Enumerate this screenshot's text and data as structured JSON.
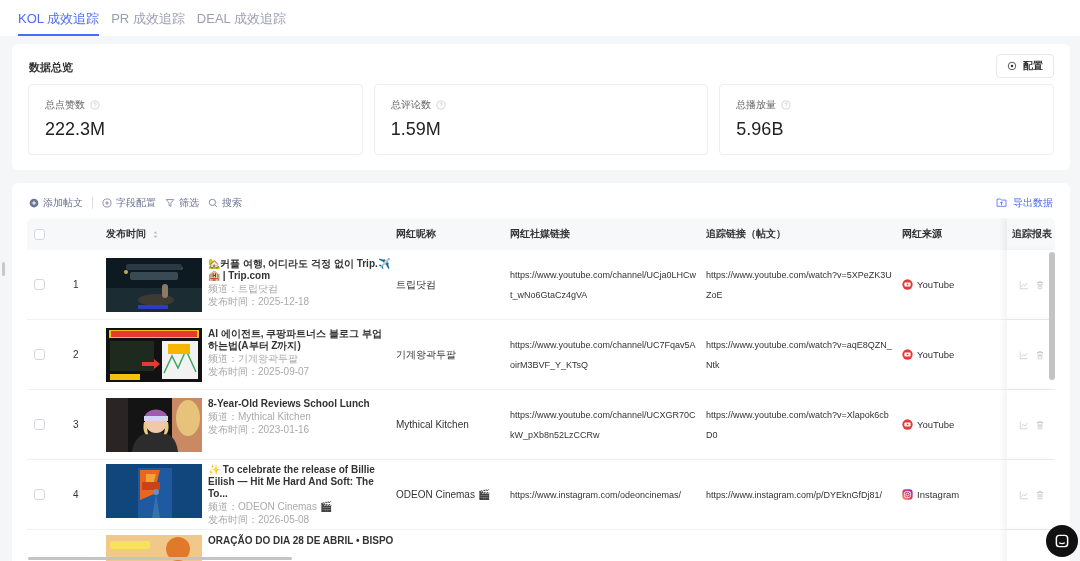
{
  "tabs": [
    {
      "label": "KOL 成效追踪",
      "selected": true
    },
    {
      "label": "PR 成效追踪",
      "selected": false
    },
    {
      "label": "DEAL 成效追踪",
      "selected": false
    }
  ],
  "overview": {
    "title": "数据总览",
    "config_button": "配置",
    "stats": [
      {
        "label": "总点赞数",
        "value": "222.3M"
      },
      {
        "label": "总评论数",
        "value": "1.59M"
      },
      {
        "label": "总播放量",
        "value": "5.96B"
      }
    ]
  },
  "toolbar": {
    "actions": [
      {
        "kind": "add",
        "label": "添加帖文"
      },
      {
        "kind": "fields",
        "label": "字段配置"
      },
      {
        "kind": "filter",
        "label": "筛选"
      },
      {
        "kind": "search",
        "label": "搜索"
      }
    ],
    "export": "导出数据"
  },
  "table": {
    "header_checked": false,
    "columns": [
      "发布时间",
      "网红昵称",
      "网红社媒链接",
      "追踪链接（帖文）",
      "网红来源",
      "追踪报表"
    ],
    "rows": [
      {
        "checked": false,
        "index": "1",
        "title": "🏡커플 여행, 어디라도 걱정 없이 Trip.✈️🏨 | Trip.com",
        "channel": "频道：트립닷컴",
        "published": "发布时间：2025-12-18",
        "nickname": "트립닷컴",
        "social_link": "https://www.youtube.com/channel/UCja0LHCwt_wNo6GtaCz4gVA",
        "tracking_link": "https://www.youtube.com/watch?v=5XPeZK3UZoE",
        "source": {
          "kind": "youtube",
          "label": "YouTube"
        }
      },
      {
        "checked": false,
        "index": "2",
        "title": "AI 에이전트, 쿠팡파트너스 블로그 부업 하는법(A부터 Z까지)",
        "channel": "频道：기계왕곽두팔",
        "published": "发布时间：2025-09-07",
        "nickname": "기계왕곽두팔",
        "social_link": "https://www.youtube.com/channel/UC7Fqav5AoirM3BVF_Y_KTsQ",
        "tracking_link": "https://www.youtube.com/watch?v=aqE8QZN_Ntk",
        "source": {
          "kind": "youtube",
          "label": "YouTube"
        }
      },
      {
        "checked": false,
        "index": "3",
        "title": "8-Year-Old Reviews School Lunch",
        "channel": "频道：Mythical Kitchen",
        "published": "发布时间：2023-01-16",
        "nickname": "Mythical Kitchen",
        "social_link": "https://www.youtube.com/channel/UCXGR70CkW_pXb8n52LzCCRw",
        "tracking_link": "https://www.youtube.com/watch?v=Xlapok6cbD0",
        "source": {
          "kind": "youtube",
          "label": "YouTube"
        }
      },
      {
        "checked": false,
        "index": "4",
        "title": "✨ To celebrate the release of Billie Eilish — Hit Me Hard And Soft: The To...",
        "channel": "频道：ODEON Cinemas 🎬",
        "published": "发布时间：2026-05-08",
        "nickname": "ODEON Cinemas 🎬",
        "social_link": "https://www.instagram.com/odeoncinemas/",
        "tracking_link": "https://www.instagram.com/p/DYEknGfDj81/",
        "source": {
          "kind": "instagram",
          "label": "Instagram"
        }
      },
      {
        "title": "ORAÇÃO DO DIA 28 DE ABRIL • BISPO"
      }
    ]
  }
}
